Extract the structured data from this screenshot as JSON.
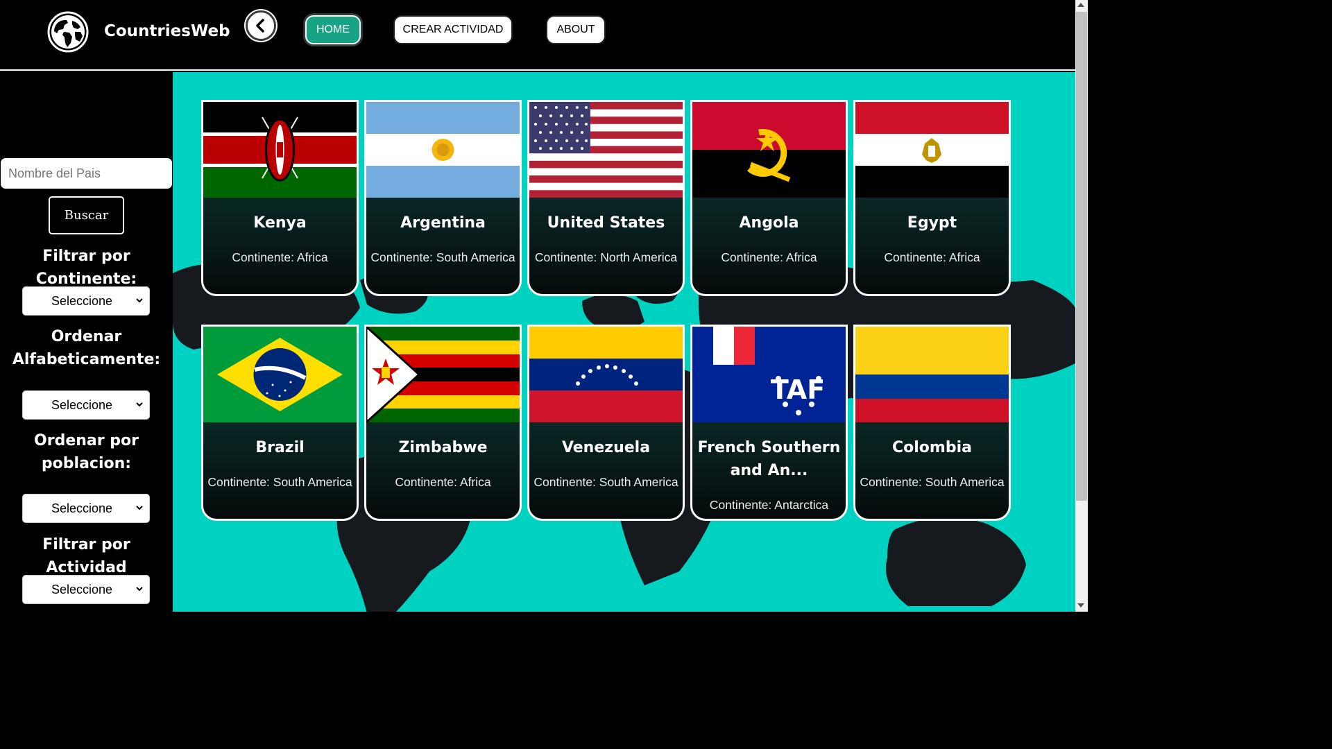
{
  "header": {
    "brand": "CountriesWeb",
    "back_icon": "chevron-left-icon",
    "nav": [
      {
        "label": "HOME",
        "active": true
      },
      {
        "label": "CREAR ACTIVIDAD",
        "active": false
      },
      {
        "label": "ABOUT",
        "active": false
      }
    ]
  },
  "sidebar": {
    "search_placeholder": "Nombre del Pais",
    "search_button": "Buscar",
    "filter_continent_label": "Filtrar por Continente:",
    "sort_alpha_label": "Ordenar Alfabeticamente:",
    "sort_population_label": "Ordenar por poblacion:",
    "filter_activity_label": "Filtrar por Actividad",
    "select_value": "Seleccione"
  },
  "countries": [
    {
      "name": "Kenya",
      "continent": "Continente: Africa"
    },
    {
      "name": "Argentina",
      "continent": "Continente: South America"
    },
    {
      "name": "United States",
      "continent": "Continente: North America"
    },
    {
      "name": "Angola",
      "continent": "Continente: Africa"
    },
    {
      "name": "Egypt",
      "continent": "Continente: Africa"
    },
    {
      "name": "Brazil",
      "continent": "Continente: South America"
    },
    {
      "name": "Zimbabwe",
      "continent": "Continente: Africa"
    },
    {
      "name": "Venezuela",
      "continent": "Continente: South America"
    },
    {
      "name": "French Southern and An...",
      "continent": "Continente: Antarctica"
    },
    {
      "name": "Colombia",
      "continent": "Continente: South America"
    }
  ],
  "colors": {
    "background_accent": "#00d2c2",
    "home_button": "#17a384",
    "card_gradient_top": "#00504b"
  }
}
